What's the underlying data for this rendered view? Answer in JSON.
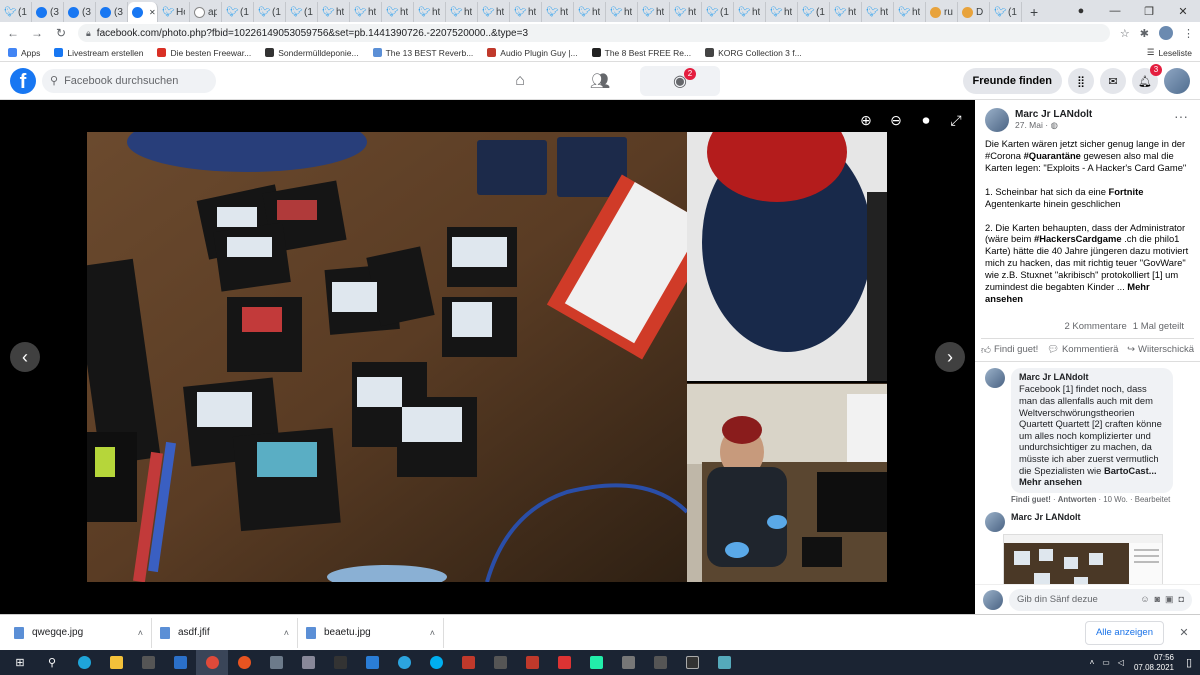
{
  "browser": {
    "tabs": [
      {
        "icon": "twitter",
        "title": "(1)"
      },
      {
        "icon": "facebook",
        "title": "(3)"
      },
      {
        "icon": "facebook",
        "title": "(3)"
      },
      {
        "icon": "facebook",
        "title": "(3)"
      },
      {
        "icon": "facebook",
        "title": "",
        "active": true
      },
      {
        "icon": "twitter",
        "title": "Ho"
      },
      {
        "icon": "google",
        "title": "ap"
      },
      {
        "icon": "twitter",
        "title": "(1)"
      },
      {
        "icon": "twitter",
        "title": "(1)"
      },
      {
        "icon": "twitter",
        "title": "(1)"
      },
      {
        "icon": "twitter",
        "title": "ht"
      },
      {
        "icon": "twitter",
        "title": "ht"
      },
      {
        "icon": "twitter",
        "title": "ht"
      },
      {
        "icon": "twitter",
        "title": "ht"
      },
      {
        "icon": "twitter",
        "title": "ht"
      },
      {
        "icon": "twitter",
        "title": "ht"
      },
      {
        "icon": "twitter",
        "title": "ht"
      },
      {
        "icon": "twitter",
        "title": "ht"
      },
      {
        "icon": "twitter",
        "title": "ht"
      },
      {
        "icon": "twitter",
        "title": "ht"
      },
      {
        "icon": "twitter",
        "title": "ht"
      },
      {
        "icon": "twitter",
        "title": "ht"
      },
      {
        "icon": "twitter",
        "title": "(1)"
      },
      {
        "icon": "twitter",
        "title": "ht"
      },
      {
        "icon": "twitter",
        "title": "ht"
      },
      {
        "icon": "twitter",
        "title": "(1)"
      },
      {
        "icon": "twitter",
        "title": "ht"
      },
      {
        "icon": "twitter",
        "title": "ht"
      },
      {
        "icon": "twitter",
        "title": "ht"
      },
      {
        "icon": "other",
        "title": "ru"
      },
      {
        "icon": "other",
        "title": "D"
      },
      {
        "icon": "twitter",
        "title": "(1)"
      }
    ],
    "url": "facebook.com/photo.php?fbid=10226149053059756&set=pb.1441390726.-2207520000..&type=3",
    "bookmarks": [
      {
        "label": "Apps",
        "color": "#4285f4"
      },
      {
        "label": "Livestream erstellen",
        "color": "#1877f2"
      },
      {
        "label": "Die besten Freewar...",
        "color": "#d93025"
      },
      {
        "label": "Sondermülldeponie...",
        "color": "#333333"
      },
      {
        "label": "The 13 BEST Reverb...",
        "color": "#5b8fd6"
      },
      {
        "label": "Audio Plugin Guy |...",
        "color": "#c0392b"
      },
      {
        "label": "The 8 Best FREE Re...",
        "color": "#222222"
      },
      {
        "label": "KORG Collection 3 f...",
        "color": "#444444"
      }
    ],
    "reading_list": "Leseliste"
  },
  "facebook": {
    "search_placeholder": "Facebook durchsuchen",
    "groups_badge": "2",
    "find_friends": "Freunde finden",
    "notif_badge": "3"
  },
  "post": {
    "author": "Marc Jr LANdolt",
    "date": "27. Mai",
    "para1_a": "Die Karten wären jetzt sicher genug lange in der #Corona ",
    "para1_tag": "#Quarantäne",
    "para1_b": " gewesen also mal die Karten legen: \"Exploits - A Hacker's Card Game\"",
    "para2_a": "1. Scheinbar hat sich da eine ",
    "para2_bold": "Fortnite",
    "para2_b": " Agentenkarte hinein geschlichen",
    "para3_a": "2. Die Karten behaupten, dass der Administrator (wäre beim ",
    "para3_tag": "#HackersCardgame",
    "para3_b": " .ch die philo1 Karte) hätte die 40 Jahre jüngeren dazu motiviert mich zu hacken, das mit richtig teuer \"GovWare\" wie z.B. Stuxnet \"akribisch\" protokolliert [1] um zumindest die begabten Kinder ... ",
    "more_label": "Mehr ansehen",
    "comments_count": "2 Kommentare",
    "shares_count": "1 Mal geteilt",
    "like_label": "Findi guet!",
    "comment_label": "Kommentierä",
    "share_label": "Wiiterschickä"
  },
  "comments": [
    {
      "author": "Marc Jr LANdolt",
      "text": "Facebook [1] findet noch, dass man das allenfalls auch mit dem Weltverschwörungstheorien Quartett Quartett [2] craften könne um alles noch komplizierter und undurchsichtiger zu machen, da müsste ich aber zuerst vermutlich die Spezialisten wie ",
      "mention": "BartoCast",
      "more": "... Mehr ansehen",
      "like": "Findi guet!",
      "reply": "Antworten",
      "time": "10 Wo.",
      "edited": "Bearbeitet"
    },
    {
      "author": "Marc Jr LANdolt"
    }
  ],
  "reply_placeholder": "Gib din Sänf dezue",
  "downloads": [
    {
      "name": "qwegqe.jpg"
    },
    {
      "name": "asdf.jfif"
    },
    {
      "name": "beaetu.jpg"
    }
  ],
  "show_all": "Alle anzeigen",
  "taskbar": {
    "time": "07:56",
    "date": "07.08.2021"
  }
}
